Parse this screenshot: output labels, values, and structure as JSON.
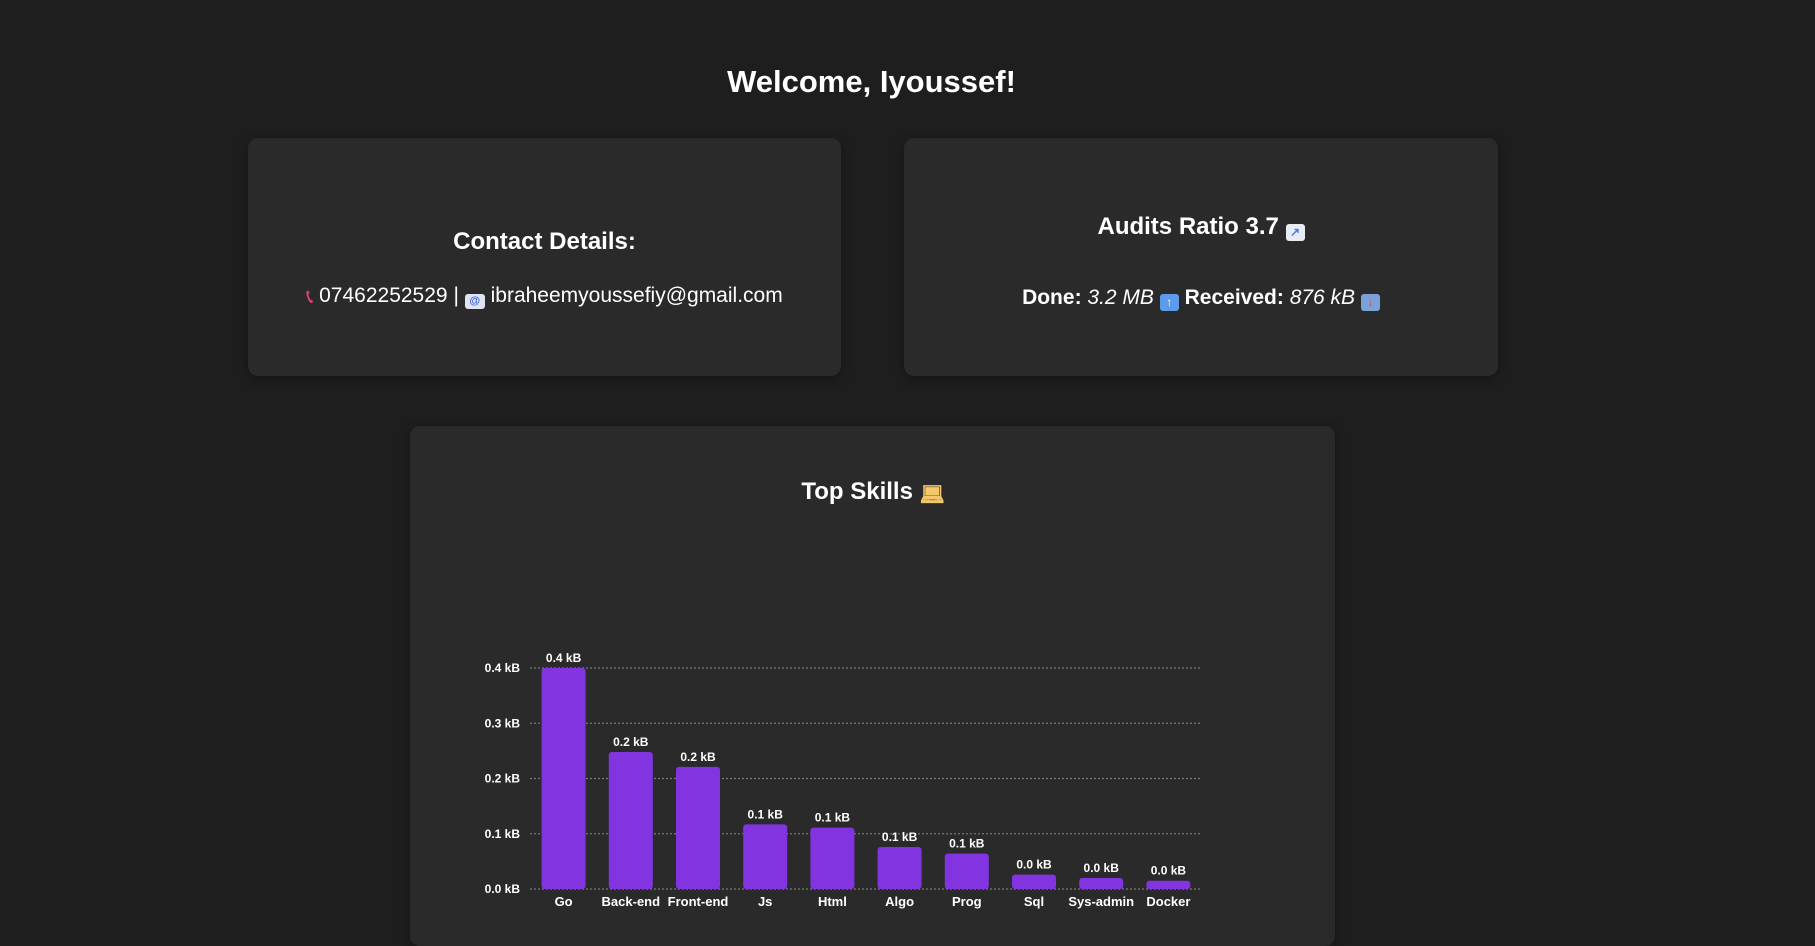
{
  "welcome": "Welcome, Iyoussef!",
  "contact": {
    "title": "Contact Details:",
    "phone_icon": "phone-icon",
    "phone": "07462252529",
    "separator": "|",
    "email_icon": "email-icon",
    "email": "ibraheemyoussefiy@gmail.com"
  },
  "audit": {
    "title": "Audits Ratio 3.7",
    "title_icon": "chart-increasing-icon",
    "done_label": "Done:",
    "done_value": "3.2 MB",
    "done_icon": "up-arrow-icon",
    "received_label": "Received:",
    "received_value": "876 kB",
    "received_icon": "inbox-tray-icon"
  },
  "skills": {
    "title": "Top Skills",
    "title_icon": "technologist-icon"
  },
  "chart_data": {
    "type": "bar",
    "categories": [
      "Go",
      "Back-end",
      "Front-end",
      "Js",
      "Html",
      "Algo",
      "Prog",
      "Sql",
      "Sys-admin",
      "Docker"
    ],
    "values": [
      0.4,
      0.248,
      0.221,
      0.117,
      0.111,
      0.076,
      0.064,
      0.026,
      0.02,
      0.015
    ],
    "data_labels": [
      "0.4 kB",
      "0.2 kB",
      "0.2 kB",
      "0.1 kB",
      "0.1 kB",
      "0.1 kB",
      "0.1 kB",
      "0.0 kB",
      "0.0 kB",
      "0.0 kB"
    ],
    "y_ticks": [
      0,
      0.1,
      0.2,
      0.3,
      0.4
    ],
    "y_tick_labels": [
      "0.0 kB",
      "0.1 kB",
      "0.2 kB",
      "0.3 kB",
      "0.4 kB"
    ],
    "ylim": [
      0,
      0.4
    ],
    "grid": true,
    "bar_color": "#8134e0",
    "grid_color": "#777777"
  }
}
